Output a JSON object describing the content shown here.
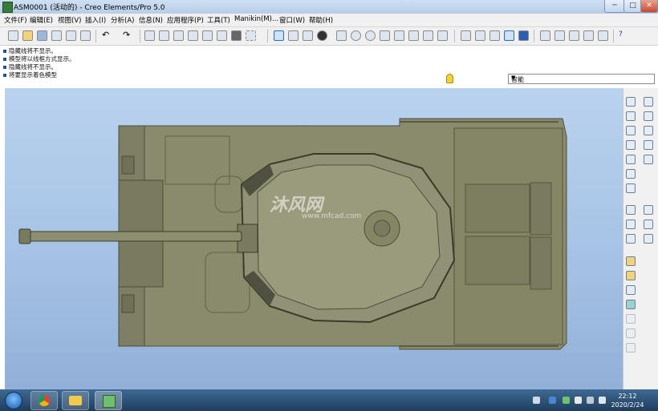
{
  "window": {
    "title": "ASM0001 (活动的) - Creo Elements/Pro 5.0",
    "controls": [
      "─",
      "□",
      "✕"
    ]
  },
  "menu": [
    "文件(F)",
    "编辑(E)",
    "视图(V)",
    "插入(I)",
    "分析(A)",
    "信息(N)",
    "应用程序(P)",
    "工具(T)",
    "Manikin(M)...",
    "窗口(W)",
    "帮助(H)"
  ],
  "messages": [
    "隐藏线将不显示。",
    "模型将以线框方式显示。",
    "隐藏线将不显示。",
    "将要显示着色模型"
  ],
  "filter": {
    "value": "智能"
  },
  "watermark": {
    "cn": "沐风网",
    "url": "www.mfcad.com"
  },
  "taskbar": {
    "time": "22:12",
    "date": "2020/2/24"
  },
  "colors": {
    "model": "#8a8b6c",
    "background": "#a8c4e6",
    "taskbar": "#2a4c70"
  }
}
